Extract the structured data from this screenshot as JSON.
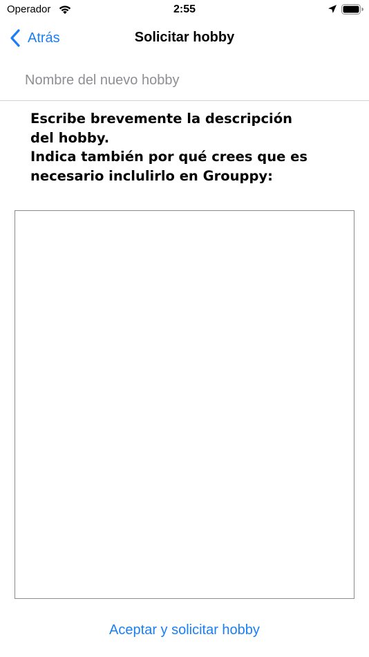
{
  "status_bar": {
    "carrier": "Operador",
    "time": "2:55",
    "icons": [
      "wifi-icon",
      "location-arrow-icon",
      "battery-icon"
    ]
  },
  "nav": {
    "back_label": "Atrás",
    "title": "Solicitar hobby"
  },
  "form": {
    "name_placeholder": "Nombre del nuevo hobby",
    "name_value": "",
    "instructions": [
      "Escribe brevemente la descripción",
      "del hobby.",
      "Indica también por qué crees que es",
      "necesario inclulirlo en Grouppy:"
    ],
    "description_value": "",
    "submit_label": "Aceptar y solicitar hobby"
  },
  "colors": {
    "accent": "#1a7ef5",
    "placeholder": "#8e8e93",
    "separator": "#d4d4d8",
    "textarea_border": "#8a8a8a"
  }
}
